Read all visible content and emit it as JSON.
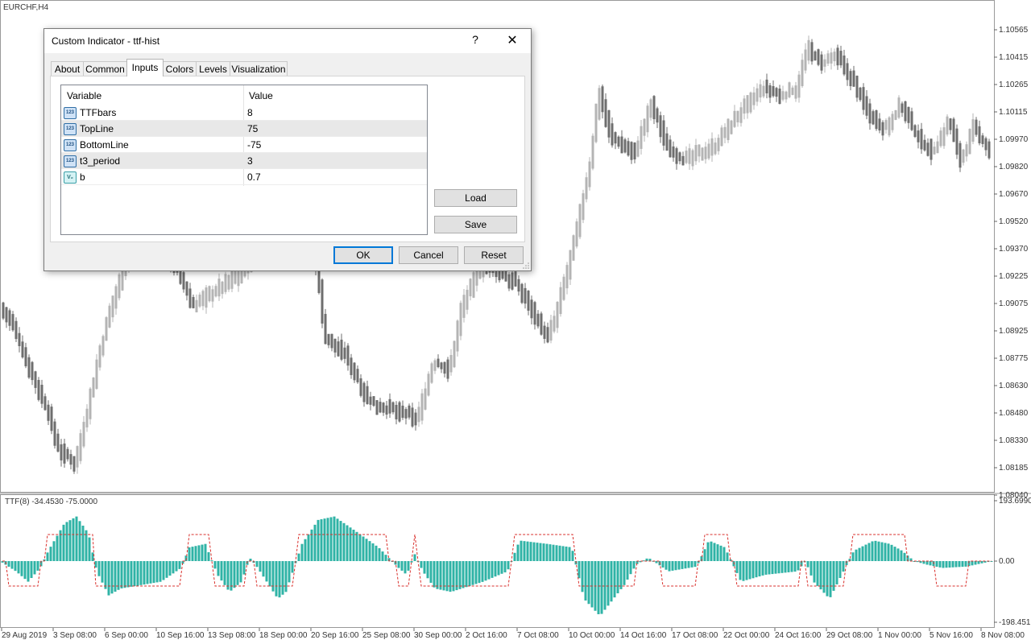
{
  "chart": {
    "symbol_label": "EURCHF,H4",
    "indicator_label": "TTF(8) -34.4530 -75.0000",
    "price_ticks": [
      "1.10565",
      "1.10415",
      "1.10265",
      "1.10115",
      "1.09970",
      "1.09820",
      "1.09670",
      "1.09520",
      "1.09370",
      "1.09225",
      "1.09075",
      "1.08925",
      "1.08775",
      "1.08630",
      "1.08480",
      "1.08330",
      "1.08185",
      "1.08040"
    ],
    "indicator_ticks": [
      "193.6990",
      "0.00",
      "-198.4512"
    ],
    "time_ticks": [
      "29 Aug 2019",
      "3 Sep 08:00",
      "6 Sep 00:00",
      "10 Sep 16:00",
      "13 Sep 08:00",
      "18 Sep 00:00",
      "20 Sep 16:00",
      "25 Sep 08:00",
      "30 Sep 00:00",
      "2 Oct 16:00",
      "7 Oct 08:00",
      "10 Oct 00:00",
      "14 Oct 16:00",
      "17 Oct 08:00",
      "22 Oct 00:00",
      "24 Oct 16:00",
      "29 Oct 08:00",
      "1 Nov 00:00",
      "5 Nov 16:00",
      "8 Nov 08:00"
    ],
    "colors": {
      "bull": "#b4b4b4",
      "bear": "#6e6e6e",
      "histogram": "#2fb3a6",
      "levels": "#d9302c",
      "grid_bg": "#ffffff"
    }
  },
  "dialog": {
    "title": "Custom Indicator - ttf-hist",
    "help_icon": "?",
    "close_icon": "✕",
    "tabs": [
      {
        "label": "About",
        "active": false
      },
      {
        "label": "Common",
        "active": false
      },
      {
        "label": "Inputs",
        "active": true
      },
      {
        "label": "Colors",
        "active": false
      },
      {
        "label": "Levels",
        "active": false
      },
      {
        "label": "Visualization",
        "active": false
      }
    ],
    "grid": {
      "headers": {
        "variable": "Variable",
        "value": "Value"
      },
      "rows": [
        {
          "icon": "integer-icon",
          "icon_text": "123",
          "name": "TTFbars",
          "value": "8"
        },
        {
          "icon": "integer-icon",
          "icon_text": "123",
          "name": "TopLine",
          "value": "75"
        },
        {
          "icon": "integer-icon",
          "icon_text": "123",
          "name": "BottomLine",
          "value": "-75"
        },
        {
          "icon": "integer-icon",
          "icon_text": "123",
          "name": "t3_period",
          "value": "3"
        },
        {
          "icon": "double-icon",
          "icon_text": "V₂",
          "name": "b",
          "value": "0.7"
        }
      ]
    },
    "buttons": {
      "load": "Load",
      "save": "Save",
      "ok": "OK",
      "cancel": "Cancel",
      "reset": "Reset"
    }
  }
}
